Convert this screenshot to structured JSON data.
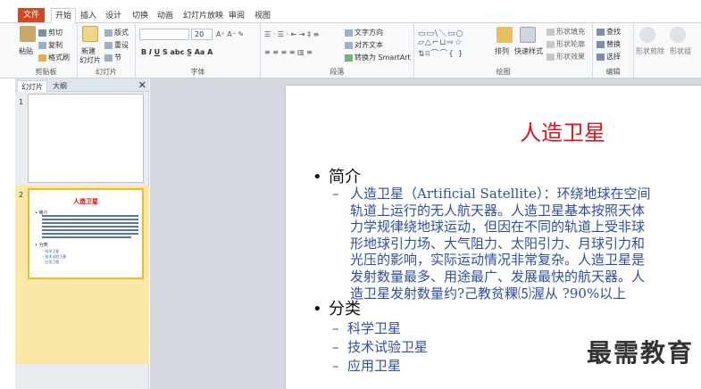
{
  "ribbon_tabs": [
    "文件",
    "开始",
    "插入",
    "设计",
    "切换",
    "动画",
    "幻灯片放映",
    "审阅",
    "视图"
  ],
  "active_tab": "开始",
  "groups": {
    "clipboard": {
      "label": "剪贴板",
      "paste": "粘贴",
      "cut": "剪切",
      "copy": "复制",
      "format_painter": "格式刷"
    },
    "slides": {
      "label": "幻灯片",
      "new_slide": "新建",
      "new_slide2": "幻灯片",
      "layout": "版式",
      "reset": "重设",
      "section": "节"
    },
    "font": {
      "label": "字体",
      "size": "20"
    },
    "paragraph": {
      "label": "段落",
      "text_direction": "文字方向",
      "align_text": "对齐文本",
      "smartart": "转换为 SmartArt"
    },
    "drawing": {
      "label": "绘图",
      "arrange": "排列",
      "quick_styles": "快速样式",
      "fill": "形状填充",
      "outline": "形状轮廓",
      "effects": "形状效果"
    },
    "editing": {
      "label": "编辑",
      "find": "查找",
      "replace": "替换",
      "select": "选择"
    },
    "extra": {
      "label1": "形状剪除",
      "label2": "形状组"
    }
  },
  "pane": {
    "tab_slides": "幻灯片",
    "tab_outline": "大纲",
    "close": "✕"
  },
  "thumbs": [
    {
      "num": "1"
    },
    {
      "num": "2",
      "title": "人造卫星",
      "b1": "• 简介",
      "b2": "• 分类",
      "s1": "– 科学卫星",
      "s2": "– 技术试验卫星",
      "s3": "– 应用卫星"
    }
  ],
  "slide": {
    "title": "人造卫星",
    "bullet1": "简介",
    "bullet2": "分类",
    "bullet_char": "•",
    "dash_char": "–",
    "intro_lines": [
      "人造卫星（Artificial Satellite）：环绕地球在空间",
      "轨道上运行的无人航天器。人造卫星基本按照天体",
      "力学规律绕地球运动，但因在不同的轨道上受非球",
      "形地球引力场、大气阻力、太阳引力、月球引力和",
      "光压的影响，实际运动情况非常复杂。人造卫星是",
      "发射数量最多、用途最广、发展最快的航天器。人",
      "造卫星发射数量约?己教贫粿⑸渥从   ?90%以上"
    ],
    "categories": [
      "科学卫星",
      "技术试验卫星",
      "应用卫星"
    ]
  },
  "watermark": "最需教育",
  "colors": {
    "file_tab": "#d24726",
    "title_red": "#e8131b",
    "body_blue": "#2e4fa2",
    "thumb_select": "#f0b92e"
  }
}
